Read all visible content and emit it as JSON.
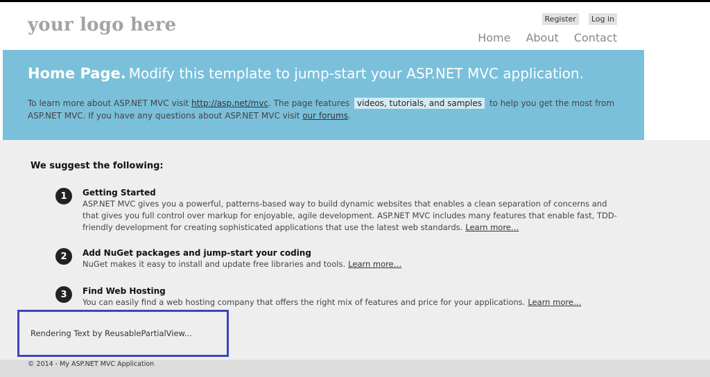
{
  "header": {
    "logo": "your logo here",
    "login": [
      "Register",
      "Log in"
    ],
    "menu": [
      "Home",
      "About",
      "Contact"
    ]
  },
  "featured": {
    "title": "Home Page.",
    "subtitle": "Modify this template to jump-start your ASP.NET MVC application.",
    "text1": "To learn more about ASP.NET MVC visit ",
    "link1": "http://asp.net/mvc",
    "text2": ". The page features ",
    "mark": "videos, tutorials, and samples",
    "text3": " to help you get the most from ASP.NET MVC. If you have any questions about ASP.NET MVC visit ",
    "link2": "our forums",
    "text4": "."
  },
  "main": {
    "heading": "We suggest the following:",
    "steps": [
      {
        "num": "1",
        "title": "Getting Started",
        "text": "ASP.NET MVC gives you a powerful, patterns-based way to build dynamic websites that enables a clean separation of concerns and that gives you full control over markup for enjoyable, agile development. ASP.NET MVC includes many features that enable fast, TDD-friendly development for creating sophisticated applications that use the latest web standards.",
        "link": "Learn more…"
      },
      {
        "num": "2",
        "title": "Add NuGet packages and jump-start your coding",
        "text": "NuGet makes it easy to install and update free libraries and tools.",
        "link": "Learn more…"
      },
      {
        "num": "3",
        "title": "Find Web Hosting",
        "text": "You can easily find a web hosting company that offers the right mix of features and price for your applications.",
        "link": "Learn more…"
      }
    ]
  },
  "partial": {
    "text": "Rendering Text by ReusablePartialView..."
  },
  "footer": {
    "text": "© 2014 - My ASP.NET MVC Application"
  }
}
